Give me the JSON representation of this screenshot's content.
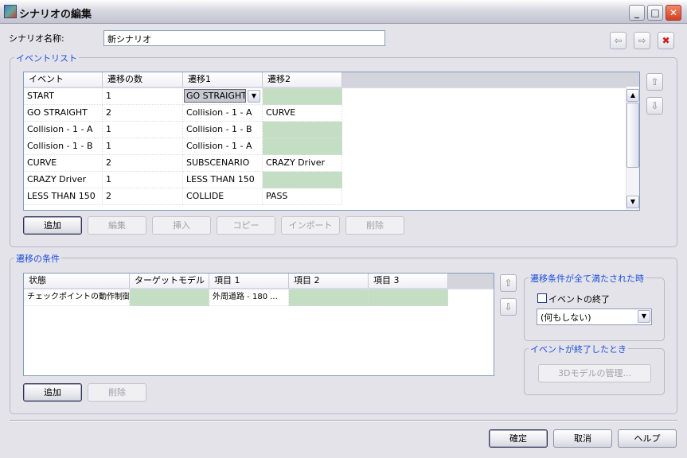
{
  "window": {
    "title": "シナリオの編集",
    "minimize": "_",
    "maximize": "□",
    "close": "✕"
  },
  "scenario_name": {
    "label": "シナリオ名称:",
    "value": "新シナリオ"
  },
  "nav": {
    "back": "⇦",
    "forward": "⇨",
    "delete": "✖"
  },
  "event_list": {
    "title": "イベントリスト",
    "columns": [
      "イベント",
      "遷移の数",
      "遷移1",
      "遷移2"
    ],
    "rows": [
      [
        "START",
        "1",
        "GO STRAIGHT",
        ""
      ],
      [
        "GO STRAIGHT",
        "2",
        "Collision - 1 - A",
        "CURVE"
      ],
      [
        "Collision - 1 - A",
        "1",
        "Collision - 1 - B",
        ""
      ],
      [
        "Collision - 1 - B",
        "1",
        "Collision - 1 - A",
        ""
      ],
      [
        "CURVE",
        "2",
        "SUBSCENARIO",
        "CRAZY Driver"
      ],
      [
        "CRAZY Driver",
        "1",
        "LESS THAN 150",
        ""
      ],
      [
        "LESS THAN 150",
        "2",
        "COLLIDE",
        "PASS"
      ]
    ],
    "buttons": [
      "追加",
      "編集",
      "挿入",
      "コピー",
      "インポート",
      "削除"
    ],
    "up": "⇧",
    "down": "⇩"
  },
  "conditions": {
    "title": "遷移の条件",
    "columns": [
      "状態",
      "ターゲットモデル",
      "項目 1",
      "項目 2",
      "項目 3"
    ],
    "rows": [
      [
        "チェックポイントの動作制御...",
        "",
        "外周道路 - 180 ...",
        "",
        ""
      ]
    ],
    "buttons": [
      "追加",
      "削除"
    ],
    "up": "⇧",
    "down": "⇩"
  },
  "all_met": {
    "title": "遷移条件が全て満たされた時",
    "checkbox_label": "イベントの終了",
    "checked": false,
    "select_value": "(何もしない)"
  },
  "event_end": {
    "title": "イベントが終了したとき",
    "button": "3Dモデルの管理..."
  },
  "footer": {
    "ok": "確定",
    "cancel": "取消",
    "help": "ヘルプ"
  },
  "colors": {
    "empty_cell": "#c4dec4",
    "group_title": "#1c4fd8"
  }
}
